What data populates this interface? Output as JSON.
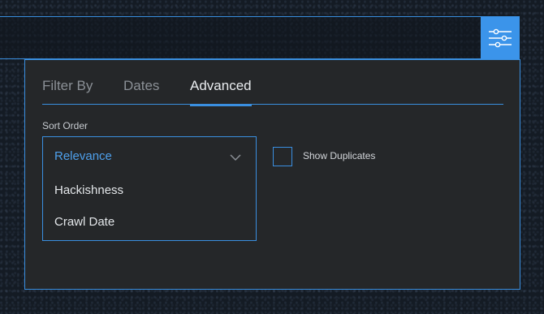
{
  "toolbar": {
    "filter_toggle_icon": "sliders-icon"
  },
  "tabs": [
    {
      "label": "Filter By",
      "active": false
    },
    {
      "label": "Dates",
      "active": false
    },
    {
      "label": "Advanced",
      "active": true
    }
  ],
  "sort": {
    "label": "Sort Order",
    "selected": "Relevance",
    "options": [
      "Hackishness",
      "Crawl Date"
    ]
  },
  "duplicates": {
    "label": "Show Duplicates",
    "checked": false
  },
  "colors": {
    "accent": "#3a8fe0",
    "panel_bg": "#252729",
    "selected_text": "#4ea0ec"
  }
}
